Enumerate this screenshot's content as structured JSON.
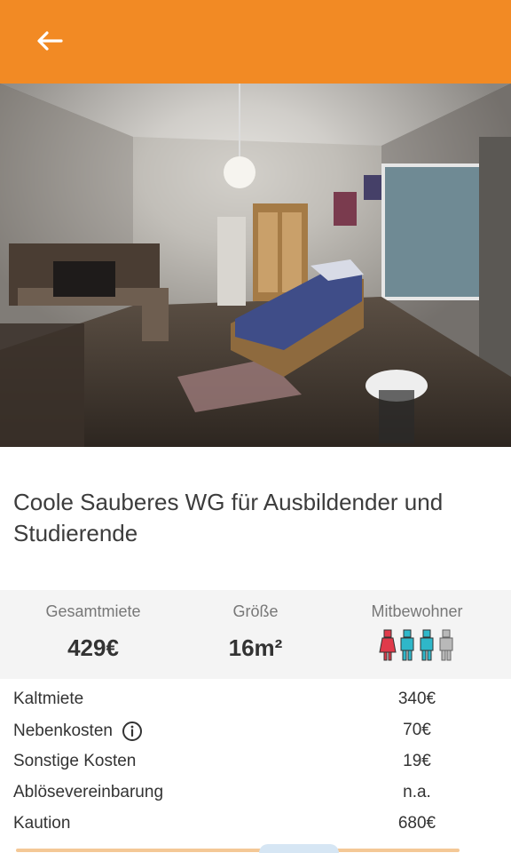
{
  "header": {
    "back_icon": "arrow-left-icon",
    "background_color": "#f28a24"
  },
  "gallery": {
    "image_description_icon": "room-photo",
    "total_images": 8,
    "active_index": 0
  },
  "listing": {
    "title": "Coole Sauberes WG für Ausbildender und Studierende"
  },
  "stats": {
    "rent": {
      "label": "Gesamtmiete",
      "value": "429€"
    },
    "size": {
      "label": "Größe",
      "value": "16m²"
    },
    "roommates": {
      "label": "Mitbewohner",
      "icons": [
        {
          "icon": "person-female-icon",
          "color": "#e03a4a"
        },
        {
          "icon": "person-male-icon",
          "color": "#2fb7c9"
        },
        {
          "icon": "person-male-icon",
          "color": "#2fb7c9"
        },
        {
          "icon": "person-empty-icon",
          "color": "#b9b9b9"
        }
      ]
    }
  },
  "costs": [
    {
      "label": "Kaltmiete",
      "value": "340€",
      "info": false
    },
    {
      "label": "Nebenkosten",
      "value": "70€",
      "info": true
    },
    {
      "label": "Sonstige Kosten",
      "value": "19€",
      "info": false
    },
    {
      "label": "Ablösevereinbarung",
      "value": "n.a.",
      "info": false
    },
    {
      "label": "Kaution",
      "value": "680€",
      "info": false
    }
  ]
}
